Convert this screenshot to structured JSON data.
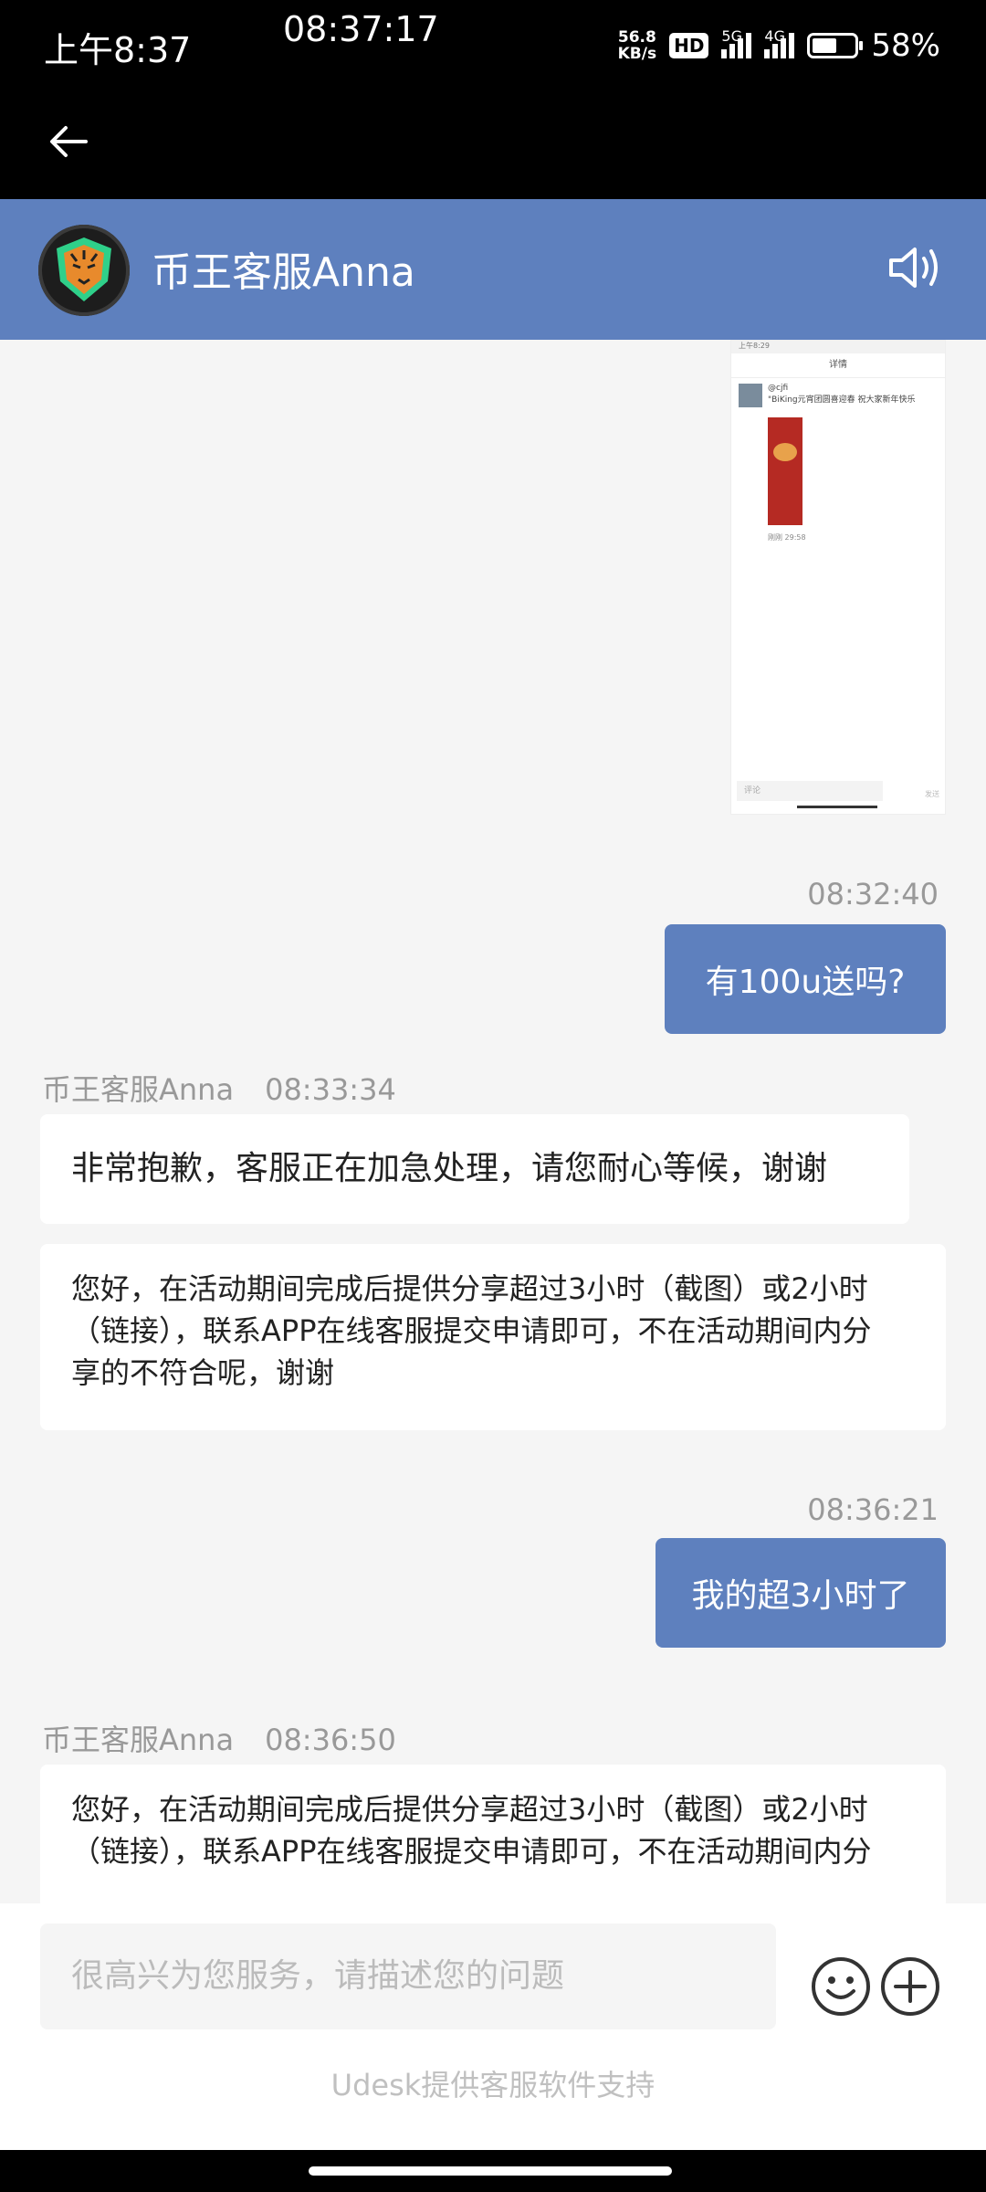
{
  "status_bar": {
    "time": "上午8:37",
    "clock": "08:37:17",
    "net_speed_value": "56.8",
    "net_speed_unit": "KB/s",
    "hd": "HD",
    "network_5g": "5G",
    "network_4g": "4G",
    "battery_percent": "58%",
    "battery_level": 0.58
  },
  "header": {
    "title": "币王客服Anna"
  },
  "chat": {
    "messages": [
      {
        "type": "image",
        "direction": "out",
        "thumbnail": {
          "status_time": "上午8:29",
          "top_title": "详情",
          "user": "@cjfi",
          "post_text": "\"BiKing元宵团圆喜迎春 祝大家新年快乐",
          "post_time": "刚刚 29:58",
          "comment_placeholder": "评论",
          "send": "发送"
        }
      },
      {
        "type": "text",
        "direction": "out",
        "timestamp": "08:32:40",
        "text": "有100u送吗?"
      },
      {
        "type": "text",
        "direction": "in",
        "sender": "币王客服Anna",
        "timestamp": "08:33:34",
        "text": "非常抱歉，客服正在加急处理，请您耐心等候，谢谢"
      },
      {
        "type": "text",
        "direction": "in",
        "text_lines": [
          "您好，在活动期间完成后提供分享超过3小时（截图）或2小时",
          "（链接），联系APP在线客服提交申请即可，不在活动期间内分",
          "享的不符合呢，谢谢"
        ]
      },
      {
        "type": "text",
        "direction": "out",
        "timestamp": "08:36:21",
        "text": "我的超3小时了"
      },
      {
        "type": "text",
        "direction": "in",
        "sender": "币王客服Anna",
        "timestamp": "08:36:50",
        "text_lines": [
          "您好，在活动期间完成后提供分享超过3小时（截图）或2小时",
          "（链接），联系APP在线客服提交申请即可，不在活动期间内分"
        ]
      }
    ]
  },
  "input": {
    "placeholder": "很高兴为您服务，请描述您的问题",
    "powered_by": "Udesk提供客服软件支持"
  },
  "icons": {
    "back": "arrow-left-icon",
    "speaker": "speaker-icon",
    "emoji": "smiley-icon",
    "add": "plus-circle-icon"
  },
  "colors": {
    "brand": "#5e80be",
    "background": "#f5f5f5",
    "status_bar": "#000000"
  }
}
